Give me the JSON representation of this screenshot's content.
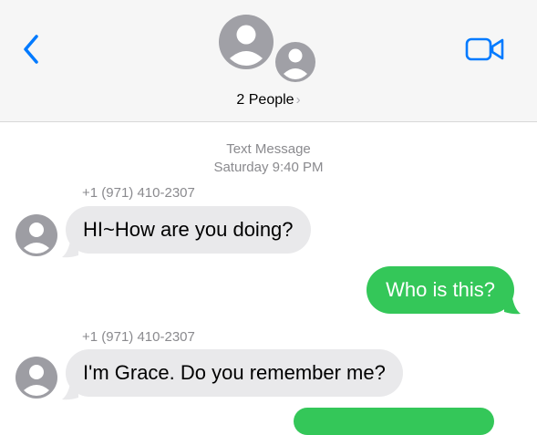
{
  "header": {
    "group_label": "2 People",
    "icons": {
      "back": "chevron-left-icon",
      "video": "video-camera-icon",
      "chevron": "chevron-right-icon"
    },
    "accent_color": "#007aff"
  },
  "conversation": {
    "service": "Text Message",
    "timestamp": "Saturday 9:40 PM",
    "messages": [
      {
        "sender": "+1 (971) 410-2307",
        "direction": "incoming",
        "text": "HI~How are you doing?"
      },
      {
        "direction": "outgoing",
        "text": "Who is this?"
      },
      {
        "sender": "+1 (971) 410-2307",
        "direction": "incoming",
        "text": "I'm Grace. Do you remember me?"
      }
    ]
  },
  "colors": {
    "incoming_bubble": "#e9e9eb",
    "outgoing_bubble": "#34c759",
    "meta_text": "#8a8a8e",
    "avatar_bg": "#9d9da3"
  }
}
